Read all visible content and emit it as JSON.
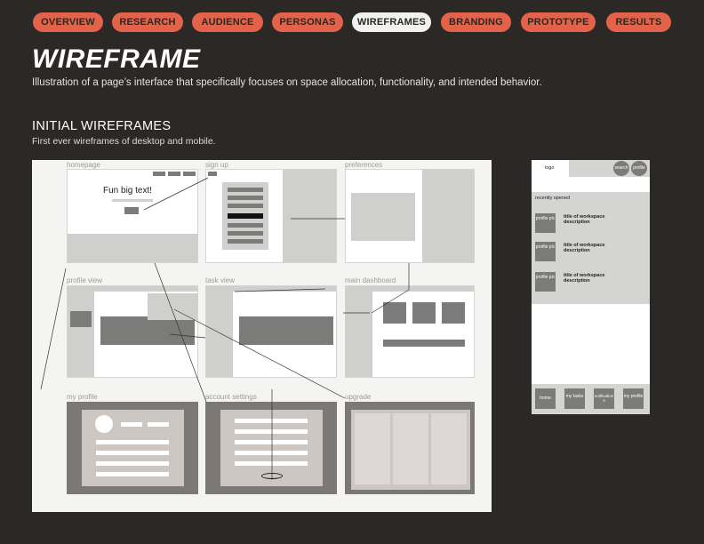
{
  "nav": {
    "items": [
      "OVERVIEW",
      "RESEARCH",
      "AUDIENCE",
      "PERSONAS",
      "WIREFRAMES",
      "BRANDING",
      "PROTOTYPE",
      "RESULTS"
    ],
    "active": "WIREFRAMES",
    "accent_color": "#e2624a",
    "active_color": "#f1f1ef"
  },
  "page": {
    "title": "WIREFRAME",
    "description": "Illustration of a page’s interface that specifically focuses on space allocation, functionality, and intended behavior."
  },
  "section": {
    "title": "INITIAL WIREFRAMES",
    "subtitle": "First ever wireframes of desktop and mobile."
  },
  "desktop": {
    "labels": {
      "homepage": "homepage",
      "sign_up": "sign up",
      "preferences": "preferences",
      "profile_view": "profile view",
      "task_view": "task view",
      "main_dashboard": "main dashboard",
      "my_profile": "my profile",
      "account_settings": "account settings",
      "upgrade": "upgrade"
    },
    "home_headline": "Fun big text!"
  },
  "mobile": {
    "logo": "logo",
    "search": "search",
    "profile": "profile",
    "recently_opened": "recently opened",
    "items": [
      {
        "pic": "profile pic",
        "title": "title of workspace",
        "desc": "description"
      },
      {
        "pic": "profile pic",
        "title": "title of workspace",
        "desc": "description"
      },
      {
        "pic": "profile pic",
        "title": "title of workspace",
        "desc": "description"
      }
    ],
    "bottom_nav": [
      "home",
      "my tasks",
      "notifications",
      "my profile"
    ]
  }
}
